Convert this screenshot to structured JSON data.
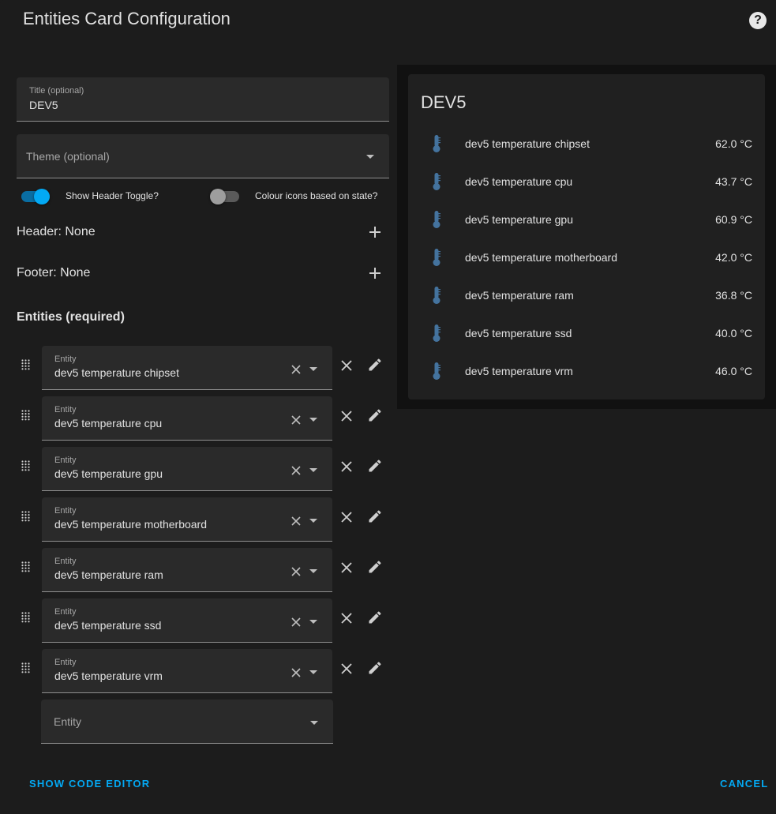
{
  "dialog": {
    "title": "Entities Card Configuration",
    "help_glyph": "?"
  },
  "editor": {
    "title_field": {
      "label": "Title (optional)",
      "value": "DEV5"
    },
    "theme_field": {
      "placeholder": "Theme (optional)"
    },
    "toggles": [
      {
        "label": "Show Header Toggle?",
        "on": true
      },
      {
        "label": "Colour icons based on state?",
        "on": false
      }
    ],
    "header_row": "Header: None",
    "footer_row": "Footer: None",
    "entities_heading": "Entities (required)",
    "entity_label": "Entity",
    "entities": [
      "dev5 temperature chipset",
      "dev5 temperature cpu",
      "dev5 temperature gpu",
      "dev5 temperature motherboard",
      "dev5 temperature ram",
      "dev5 temperature ssd",
      "dev5 temperature vrm"
    ],
    "new_entity_placeholder": "Entity"
  },
  "preview": {
    "title": "DEV5",
    "rows": [
      {
        "name": "dev5 temperature chipset",
        "value": "62.0 °C"
      },
      {
        "name": "dev5 temperature cpu",
        "value": "43.7 °C"
      },
      {
        "name": "dev5 temperature gpu",
        "value": "60.9 °C"
      },
      {
        "name": "dev5 temperature motherboard",
        "value": "42.0 °C"
      },
      {
        "name": "dev5 temperature ram",
        "value": "36.8 °C"
      },
      {
        "name": "dev5 temperature ssd",
        "value": "40.0 °C"
      },
      {
        "name": "dev5 temperature vrm",
        "value": "46.0 °C"
      }
    ]
  },
  "buttons": {
    "code_editor": "SHOW CODE EDITOR",
    "cancel": "CANCEL"
  },
  "colors": {
    "accent": "#03a9f4",
    "icon": "#44739e",
    "background": "#1c1c1c",
    "field": "#2a2a2a"
  },
  "icons": {
    "entity_row": "thermometer-icon",
    "drag": "drag-handle-icon",
    "edit": "pencil-icon",
    "remove": "close-icon",
    "add": "plus-icon"
  }
}
